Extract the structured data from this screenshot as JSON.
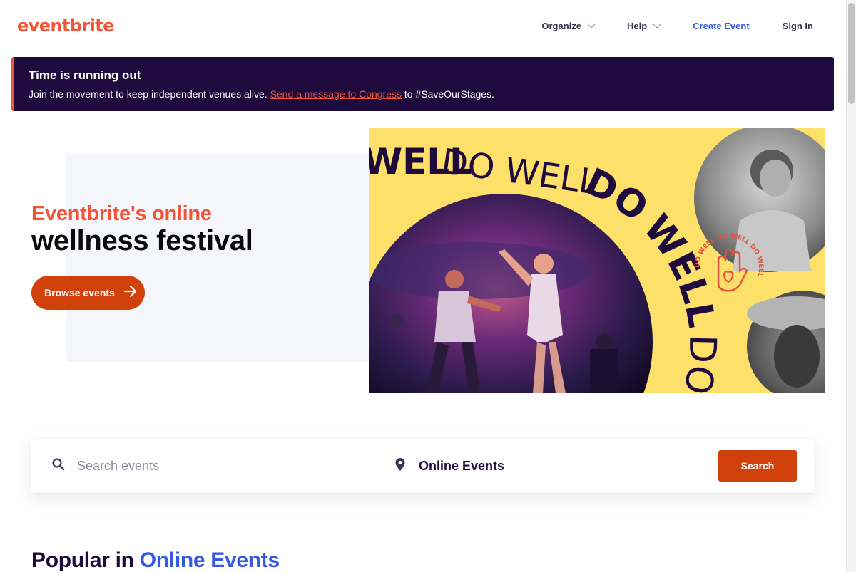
{
  "header": {
    "logo": "eventbrite",
    "nav": {
      "organize": "Organize",
      "help": "Help",
      "create_event": "Create Event",
      "sign_in": "Sign In"
    }
  },
  "banner": {
    "title": "Time is running out",
    "text_before": "Join the movement to keep independent venues alive. ",
    "link": "Send a message to Congress",
    "text_after": " to #SaveOurStages."
  },
  "hero": {
    "subtitle": "Eventbrite's online",
    "title": "wellness festival",
    "button": "Browse events",
    "image_text": {
      "line1_bold": "WELL",
      "line1_light": "DO WELL",
      "arc_bold_1": "DO",
      "arc_bold_2": "WELL",
      "arc_light": "DO",
      "seal": "DO WELL DO WELL DO WELL"
    }
  },
  "search": {
    "placeholder": "Search events",
    "location": "Online Events",
    "button": "Search"
  },
  "popular": {
    "prefix": "Popular in ",
    "location": "Online Events"
  },
  "colors": {
    "brand": "#f05537",
    "cta": "#d1410c",
    "banner_bg": "#1e0a3c",
    "link_blue": "#3659e3",
    "hero_yellow": "#fce06a"
  }
}
